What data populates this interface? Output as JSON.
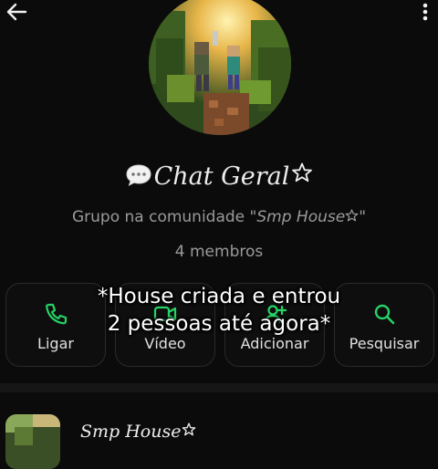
{
  "header": {
    "back_icon": "arrow-left-icon",
    "menu_icon": "more-vertical-icon"
  },
  "group": {
    "name": "Chat Geral",
    "name_prefix_icon": "speech-bubble-icon",
    "name_suffix_icon": "star-icon",
    "subtitle_prefix": "Grupo na comunidade \"",
    "community_name": "Smp House",
    "subtitle_suffix": "\"",
    "members": "4 membros"
  },
  "actions": [
    {
      "label": "Ligar",
      "icon": "phone-icon"
    },
    {
      "label": "Vídeo",
      "icon": "video-icon"
    },
    {
      "label": "Adicionar",
      "icon": "add-person-icon"
    },
    {
      "label": "Pesquisar",
      "icon": "search-icon"
    }
  ],
  "overlay_caption": {
    "line1": "*House criada e entrou",
    "line2": "2 pessoas até agora*"
  },
  "community": {
    "name": "Smp House"
  },
  "colors": {
    "background": "#0b0b0b",
    "accent": "#25d366",
    "muted_text": "#9a9a9a"
  }
}
